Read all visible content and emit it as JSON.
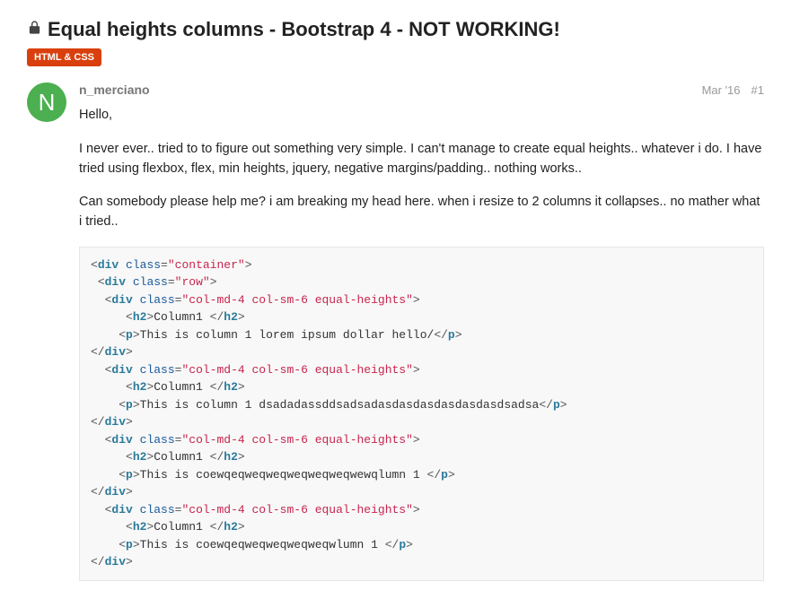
{
  "title": "Equal heights columns - Bootstrap 4 - NOT WORKING!",
  "category": "HTML & CSS",
  "avatar_letter": "N",
  "username": "n_merciano",
  "post_date": "Mar '16",
  "post_number": "#1",
  "paragraphs": {
    "p1": "Hello,",
    "p2": "I never ever.. tried to to figure out something very simple. I can't manage to create equal heights.. whatever i do. I have tried using flexbox, flex, min heights, jquery, negative margins/padding.. nothing works..",
    "p3": "Can somebody please help me? i am breaking my head here. when i resize to 2 columns it collapses.. no mather what i tried.."
  },
  "code": {
    "tags": {
      "div": "div",
      "h2": "h2",
      "p": "p"
    },
    "attrs": {
      "class": "class"
    },
    "vals": {
      "container": "\"container\"",
      "row": "\"row\"",
      "col": "\"col-md-4 col-sm-6 equal-heights\""
    },
    "text": {
      "h2": "Column1 ",
      "p1": "This is column 1 lorem ipsum dollar hello/",
      "p2": "This is column 1 dsadadassddsadsadasdasdasdasdasdasdsadsa",
      "p3": "This is coewqeqweqweqweqweqweqwewqlumn 1 ",
      "p4": "This is coewqeqweqweqweqweqwlumn 1 "
    }
  }
}
